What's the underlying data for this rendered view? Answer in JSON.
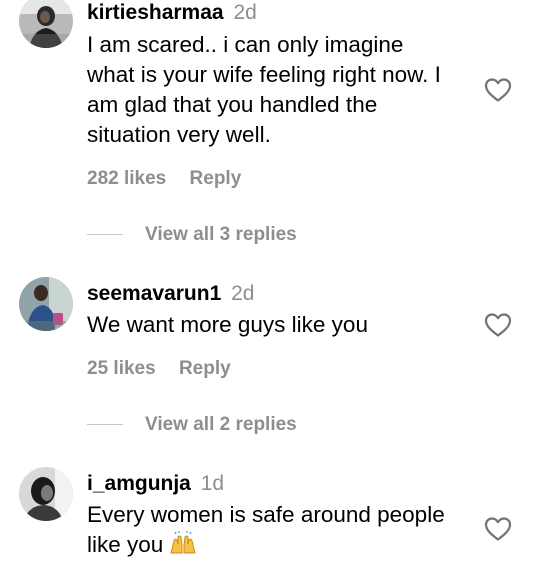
{
  "comments": [
    {
      "username": "kirtiesharmaa",
      "time": "2d",
      "lines": [
        "I am scared.. i can only imagine",
        "what is your wife feeling right now. I",
        "am glad that you handled the",
        "situation very well."
      ],
      "likes": "282 likes",
      "reply_label": "Reply",
      "view_replies": "View all 3 replies",
      "avatar_icon": "profile-photo",
      "heart_icon": "heart-outline-icon"
    },
    {
      "username": "seemavarun1",
      "time": "2d",
      "lines": [
        "We want more guys like you"
      ],
      "likes": "25 likes",
      "reply_label": "Reply",
      "view_replies": "View all 2 replies",
      "avatar_icon": "profile-photo",
      "heart_icon": "heart-outline-icon"
    },
    {
      "username": "i_amgunja",
      "time": "1d",
      "lines": [
        "Every women is safe around people",
        "like you"
      ],
      "emoji": "raising-hands-emoji",
      "avatar_icon": "profile-photo",
      "heart_icon": "heart-outline-icon"
    }
  ],
  "colors": {
    "text": "#000000",
    "secondary": "#8e8e8e",
    "divider": "#c7c7c7",
    "background": "#ffffff"
  }
}
